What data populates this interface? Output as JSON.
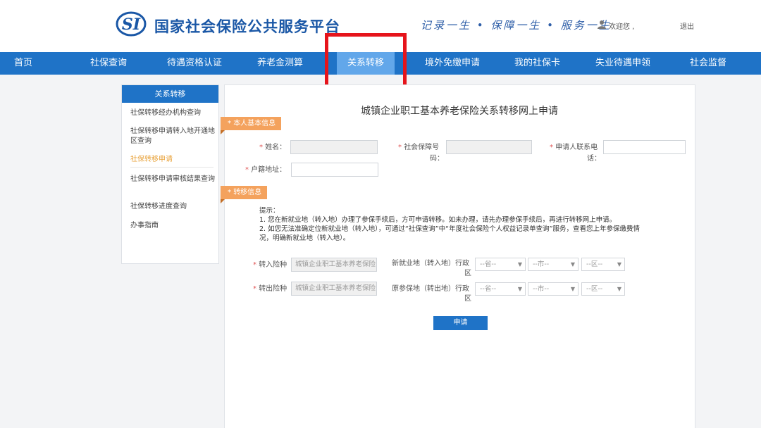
{
  "header": {
    "logo_text": "SI",
    "site_title": "国家社会保险公共服务平台",
    "slogan": "记录一生 • 保障一生 • 服务一生",
    "welcome": "欢迎您 ,",
    "logout": "退出"
  },
  "nav": {
    "items": [
      {
        "label": "首页"
      },
      {
        "label": "社保查询"
      },
      {
        "label": "待遇资格认证"
      },
      {
        "label": "养老金测算"
      },
      {
        "label": "关系转移"
      },
      {
        "label": "境外免缴申请"
      },
      {
        "label": "我的社保卡"
      },
      {
        "label": "失业待遇申领"
      },
      {
        "label": "社会监督"
      }
    ],
    "active": "关系转移"
  },
  "sidebar": {
    "title": "关系转移",
    "items": [
      {
        "label": "社保转移经办机构查询"
      },
      {
        "label": "社保转移申请转入地开通地区查询"
      },
      {
        "label": "社保转移申请"
      },
      {
        "label": "社保转移申请审核结果查询"
      },
      {
        "label": "社保转移进度查询"
      },
      {
        "label": "办事指南"
      }
    ]
  },
  "form": {
    "title": "城镇企业职工基本养老保险关系转移网上申请",
    "section_basic": "本人基本信息",
    "section_transfer": "转移信息",
    "required_mark": "*",
    "name_label": "姓名：",
    "ssn_label_1": "社会保障号",
    "ssn_label_2": "码：",
    "phone_label_1": "申请人联系电",
    "phone_label_2": "话：",
    "address_label": "户籍地址：",
    "tips_title": "提示：",
    "tip1": "1. 您在新就业地（转入地）办理了参保手续后，方可申请转移。如未办理，请先办理参保手续后，再进行转移网上申请。",
    "tip2a": "2. 如您无法准确定位新就业地（转入地），可通过“社保查询”中“年度社会保险个人权益记录单查询”服务，查看您上年参保缴费情",
    "tip2b": "况，明确新就业地（转入地）。",
    "in_type_label": "转入险种",
    "in_type_value": "城镇企业职工基本养老保险",
    "in_region_label_1": "新就业地（转入地）行政",
    "in_region_label_2": "区",
    "out_type_label": "转出险种",
    "out_type_value": "城镇企业职工基本养老保险",
    "out_region_label_1": "原参保地（转出地）行政",
    "out_region_label_2": "区",
    "province_option": "--省--",
    "city_option": "--市--",
    "district_option": "--区--",
    "submit": "申请"
  },
  "colors": {
    "nav_blue": "#1f73c7",
    "nav_active": "#62a7ea",
    "tag_orange": "#f4a25d",
    "highlight_red": "#e6141b",
    "title_blue": "#1a57a6"
  }
}
